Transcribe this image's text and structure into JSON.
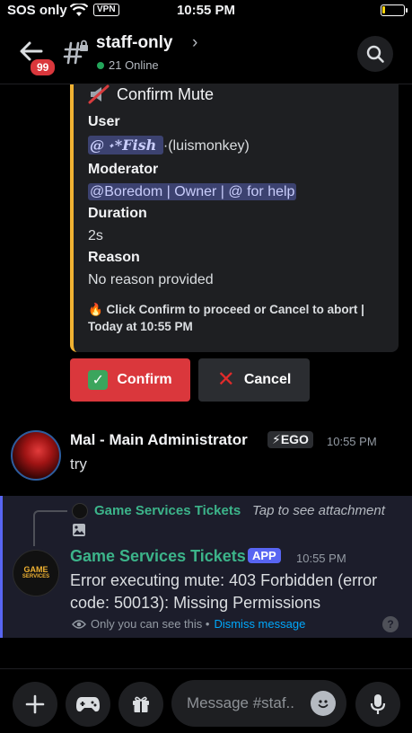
{
  "status_bar": {
    "carrier": "SOS only",
    "vpn": "VPN",
    "time": "10:55 PM"
  },
  "header": {
    "unread_badge": "99",
    "channel_name": "staff-only",
    "chevron": "›",
    "online": "21 Online"
  },
  "embed": {
    "title": "Confirm Mute",
    "accent_color": "#f0b232",
    "fields": {
      "user_label": "User",
      "user_mention": "@ ͏˖*Fish ͏",
      "user_handle": "·(luismonkey)",
      "moderator_label": "Moderator",
      "moderator_value": "@Boredom | Owner | @ for help",
      "duration_label": "Duration",
      "duration_value": "2s",
      "reason_label": "Reason",
      "reason_value": "No reason provided"
    },
    "footer": "🔥 Click Confirm to proceed or Cancel to abort | Today at 10:55 PM"
  },
  "buttons": {
    "confirm": "Confirm",
    "cancel": "Cancel"
  },
  "message1": {
    "author": "Mal - Main Administrator",
    "role_tag": "⚡EGO",
    "time": "10:55 PM",
    "text": "try"
  },
  "message2": {
    "reply_author": "Game Services Tickets",
    "reply_attachment": "Tap to see attachment",
    "avatar_text_1": "GAME",
    "avatar_text_2": "SERVICES",
    "author": "Game Services Tickets",
    "app_tag": "APP",
    "time": "10:55 PM",
    "text": "Error executing mute: 403 Forbidden (error code: 50013): Missing Permissions",
    "ephemeral_note": "Only you can see this •",
    "dismiss": "Dismiss message",
    "help": "?"
  },
  "composer": {
    "placeholder": "Message #staf.."
  }
}
